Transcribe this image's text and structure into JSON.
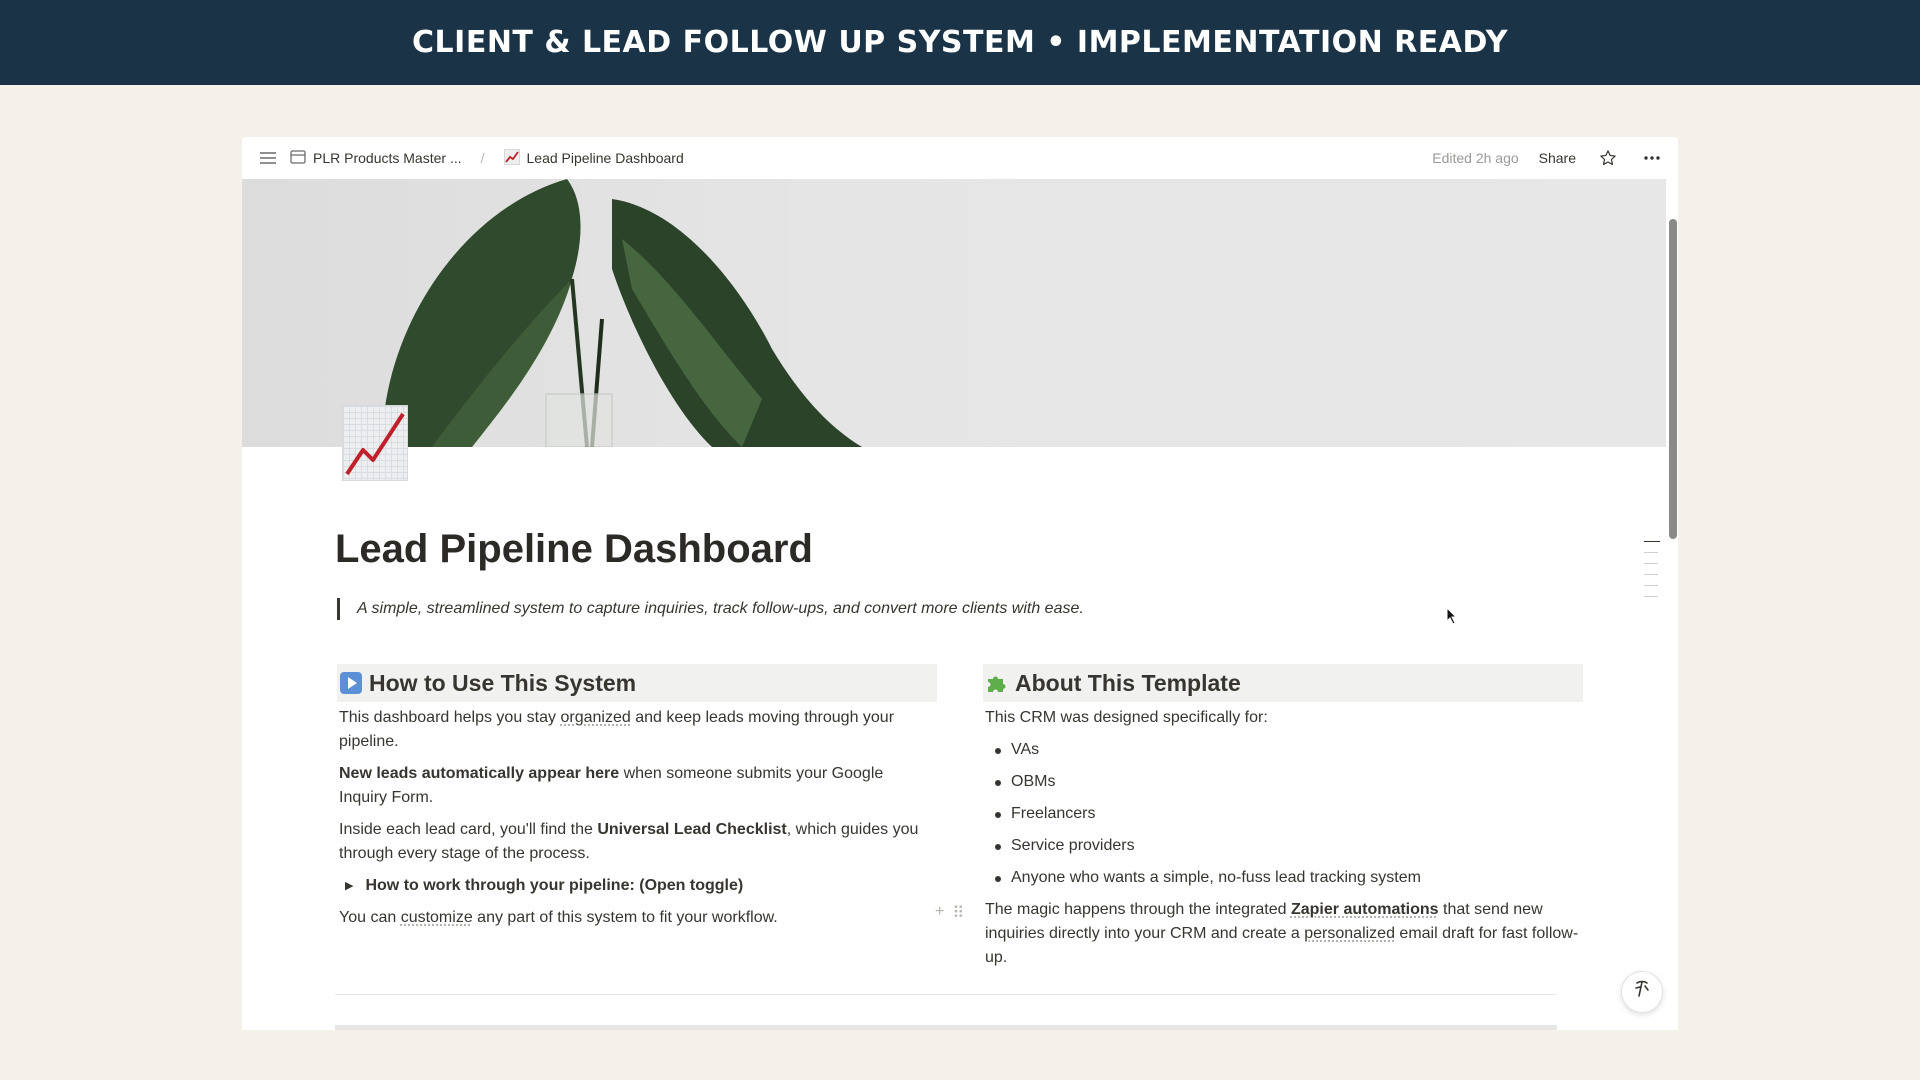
{
  "banner": {
    "text": "CLIENT & LEAD FOLLOW UP SYSTEM • IMPLEMENTATION READY"
  },
  "topbar": {
    "breadcrumb_parent": "PLR Products Master ...",
    "breadcrumb_current": "Lead Pipeline Dashboard",
    "edited": "Edited 2h ago",
    "share_label": "Share"
  },
  "page": {
    "title": "Lead Pipeline Dashboard",
    "quote": "A simple, streamlined system to capture inquiries, track follow-ups, and convert more clients with ease."
  },
  "how_to": {
    "heading": "How to Use This System",
    "p1_a": "This dashboard helps you stay ",
    "p1_b": "organized",
    "p1_c": " and keep leads moving through your pipeline.",
    "p2_bold": "New leads automatically appear here",
    "p2_rest": " when someone submits your Google Inquiry Form.",
    "p3_a": "Inside each lead card, you'll find the ",
    "p3_bold": "Universal Lead Checklist",
    "p3_c": ", which guides you through every stage of the process.",
    "toggle_label": "How to work through your pipeline: (Open toggle)",
    "p4_a": "You can ",
    "p4_b": "customize",
    "p4_c": " any part of this system to fit your workflow."
  },
  "about": {
    "heading": "About This Template",
    "intro": "This CRM was designed specifically for:",
    "audience": [
      "VAs",
      "OBMs",
      "Freelancers",
      "Service providers",
      "Anyone who wants a simple, no-fuss lead tracking system"
    ],
    "p_a": "The magic happens through the integrated ",
    "p_bold": "Zapier automations",
    "p_c": " that send new inquiries directly into your CRM and create a ",
    "p_d": "personalized",
    "p_e": " email draft for fast follow-up."
  },
  "colors": {
    "banner_bg": "#1b3346",
    "page_bg": "#f4f1eb",
    "heading_bg": "#f1f1ef",
    "text": "#37352f"
  },
  "icons": [
    "menu-icon",
    "database-icon",
    "chart-increasing-icon",
    "star-icon",
    "more-icon",
    "play-button-icon",
    "puzzle-piece-icon",
    "ai-assistant-icon"
  ]
}
